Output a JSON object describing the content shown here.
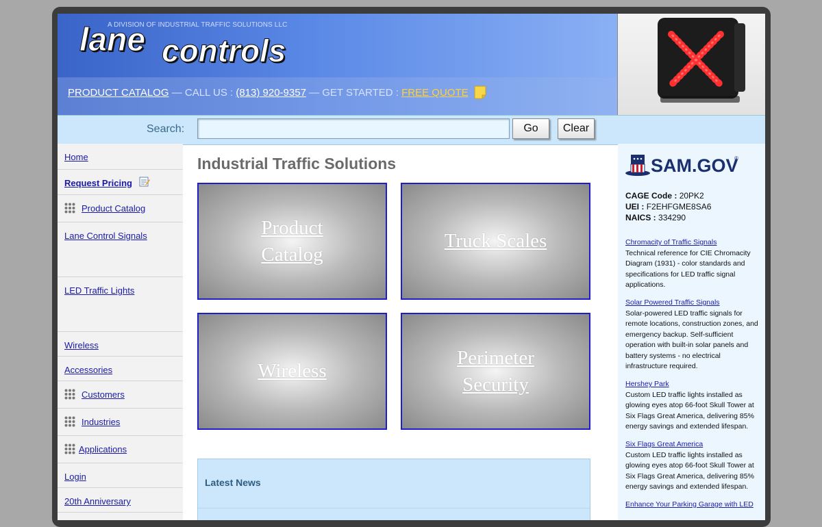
{
  "header": {
    "division": "A DIVISION OF INDUSTRIAL TRAFFIC SOLUTIONS LLC",
    "logo_text": "lanecontrols",
    "product_catalog": "PRODUCT CATALOG",
    "sep1": " — CALL US : ",
    "phone": "(813) 920-9357",
    "sep2": " — GET STARTED : ",
    "quote": "FREE QUOTE"
  },
  "search": {
    "label": "Search:",
    "value": "",
    "go": "Go",
    "clear": "Clear"
  },
  "sidebar": {
    "items": [
      {
        "label": "Home"
      },
      {
        "label": "Request Pricing"
      },
      {
        "label": "Product Catalog"
      },
      {
        "label": "Lane Control Signals"
      },
      {
        "label": "LED Traffic Lights"
      },
      {
        "label": "Wireless"
      },
      {
        "label": "Accessories"
      },
      {
        "label": "Customers"
      },
      {
        "label": "Industries"
      },
      {
        "label": "Applications"
      },
      {
        "label": "Login"
      },
      {
        "label": "20th Anniversary"
      }
    ]
  },
  "main": {
    "title": "Industrial Traffic Solutions",
    "tiles": [
      {
        "label": "Product Catalog"
      },
      {
        "label": "Truck Scales"
      },
      {
        "label": "Wireless"
      },
      {
        "label": "Perimeter Security"
      }
    ],
    "news_title": "Latest News"
  },
  "right": {
    "sam_text": "SAM.GOV",
    "cage_label": "CAGE Code :",
    "cage_value": "20PK2",
    "uei_label": "UEI :",
    "uei_value": "F2EHFGME8SA6",
    "naics_label": "NAICS :",
    "naics_value": "334290",
    "articles": [
      {
        "title": "Chromacity of Traffic Signals",
        "text": "Technical reference for CIE Chromacity Diagram (1931) - color standards and specifications for LED traffic signal applications."
      },
      {
        "title": "Solar Powered Traffic Signals",
        "text": "Solar-powered LED traffic signals for remote locations, construction zones, and emergency backup. Self-sufficient operation with built-in solar panels and battery systems - no electrical infrastructure required."
      },
      {
        "title": "Hershey Park",
        "text": "Custom LED traffic lights installed as glowing eyes atop 66-foot Skull Tower at Six Flags Great America, delivering 85% energy savings and extended lifespan."
      },
      {
        "title": "Six Flags Great America",
        "text": "Custom LED traffic lights installed as glowing eyes atop 66-foot Skull Tower at Six Flags Great America, delivering 85% energy savings and extended lifespan."
      },
      {
        "title": "Enhance Your Parking Garage with LED",
        "text": ""
      }
    ]
  },
  "colors": {
    "link": "#1a1aa6",
    "header_blue": "#3a64c8",
    "search_bg": "#cce7fb",
    "tile_border": "#1e1ec8",
    "quote": "#ffd23c"
  }
}
